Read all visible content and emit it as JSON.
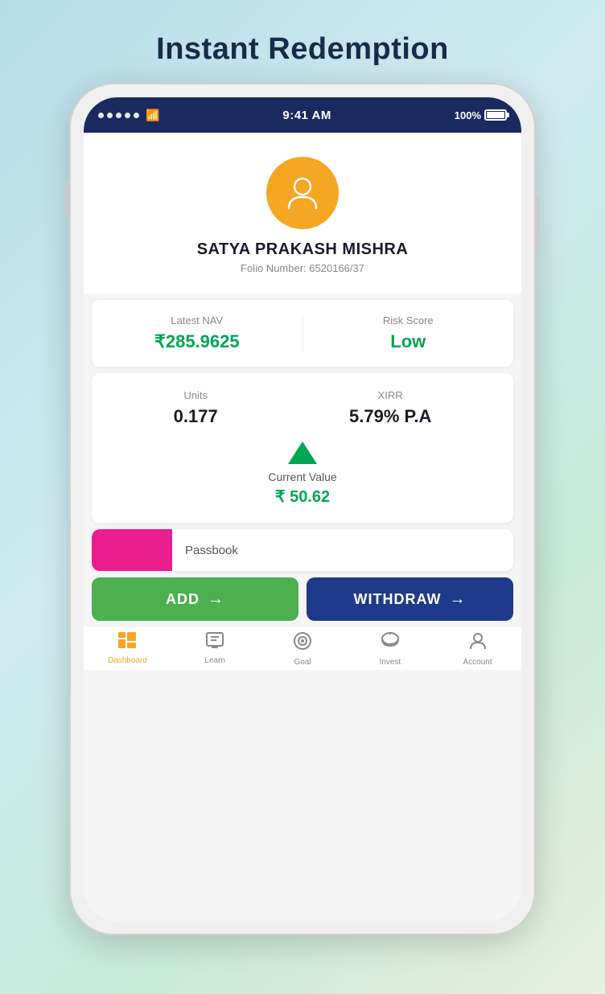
{
  "page": {
    "title": "Instant Redemption"
  },
  "status_bar": {
    "time": "9:41 AM",
    "battery": "100%"
  },
  "profile": {
    "name": "SATYA PRAKASH MISHRA",
    "folio_label": "Folio Number:",
    "folio_number": "6520166/37"
  },
  "stats": {
    "nav_label": "Latest NAV",
    "nav_value": "₹285.9625",
    "risk_label": "Risk Score",
    "risk_value": "Low"
  },
  "units": {
    "units_label": "Units",
    "units_value": "0.177",
    "xirr_label": "XIRR",
    "xirr_value": "5.79% P.A",
    "current_value_label": "Current Value",
    "current_value": "₹ 50.62"
  },
  "passbook": {
    "text": "Passbook"
  },
  "buttons": {
    "add_label": "ADD",
    "withdraw_label": "WITHDRAW"
  },
  "bottom_nav": {
    "items": [
      {
        "label": "Dashboard",
        "icon": "⊞"
      },
      {
        "label": "Learn",
        "icon": "🖥"
      },
      {
        "label": "Goal",
        "icon": "◎"
      },
      {
        "label": "Invest",
        "icon": "🐷"
      },
      {
        "label": "Account",
        "icon": "👤"
      }
    ]
  }
}
